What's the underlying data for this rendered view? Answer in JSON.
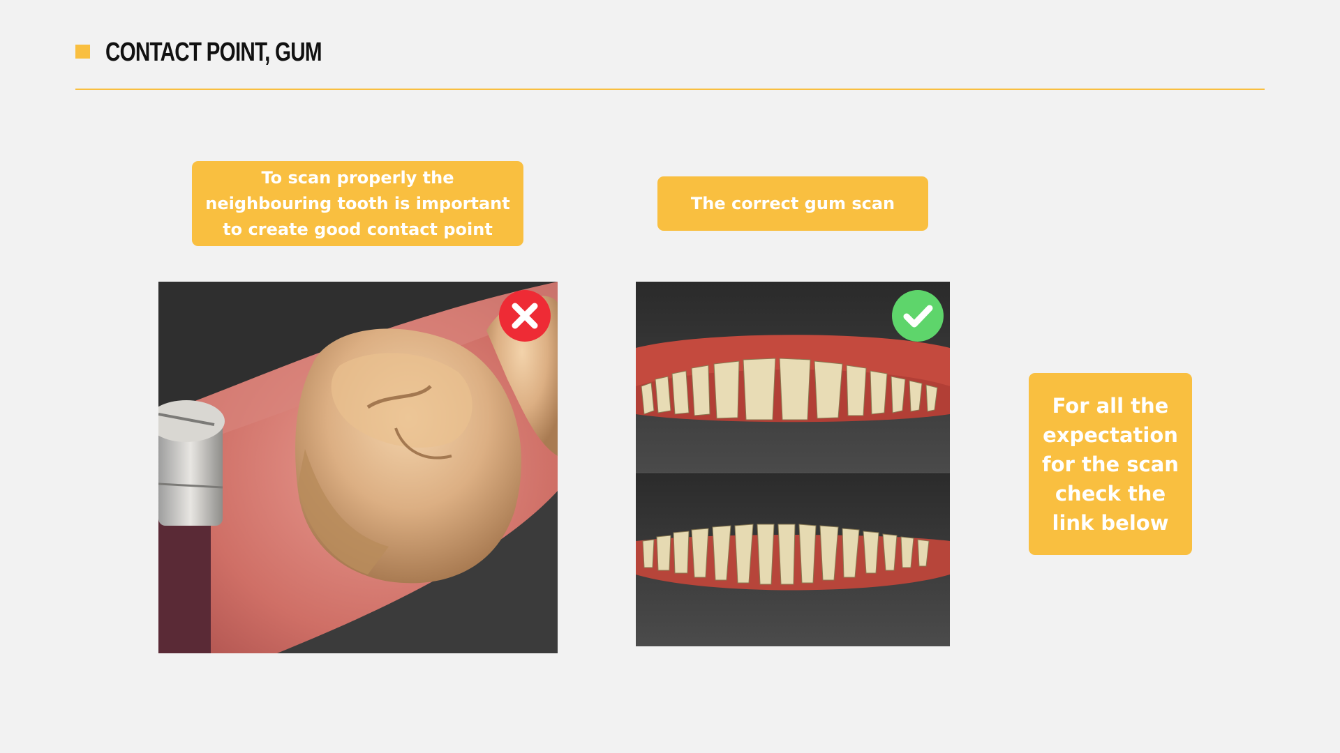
{
  "slide": {
    "title": "CONTACT POINT, GUM",
    "accent_color": "#f9bf40"
  },
  "callouts": {
    "contact_point": "To scan properly the neighbouring tooth is important to create good contact point",
    "gum": "The correct gum scan",
    "link_note": "For all the expectation for the scan check the link below"
  },
  "images": {
    "left_scan": "molar-contact-point-scan-image",
    "right_scan": "upper-lower-arch-gum-scan-image"
  },
  "icons": {
    "incorrect": "close-icon",
    "correct": "check-icon"
  },
  "colors": {
    "incorrect_badge": "#ee2b35",
    "correct_badge": "#5ed56b"
  }
}
